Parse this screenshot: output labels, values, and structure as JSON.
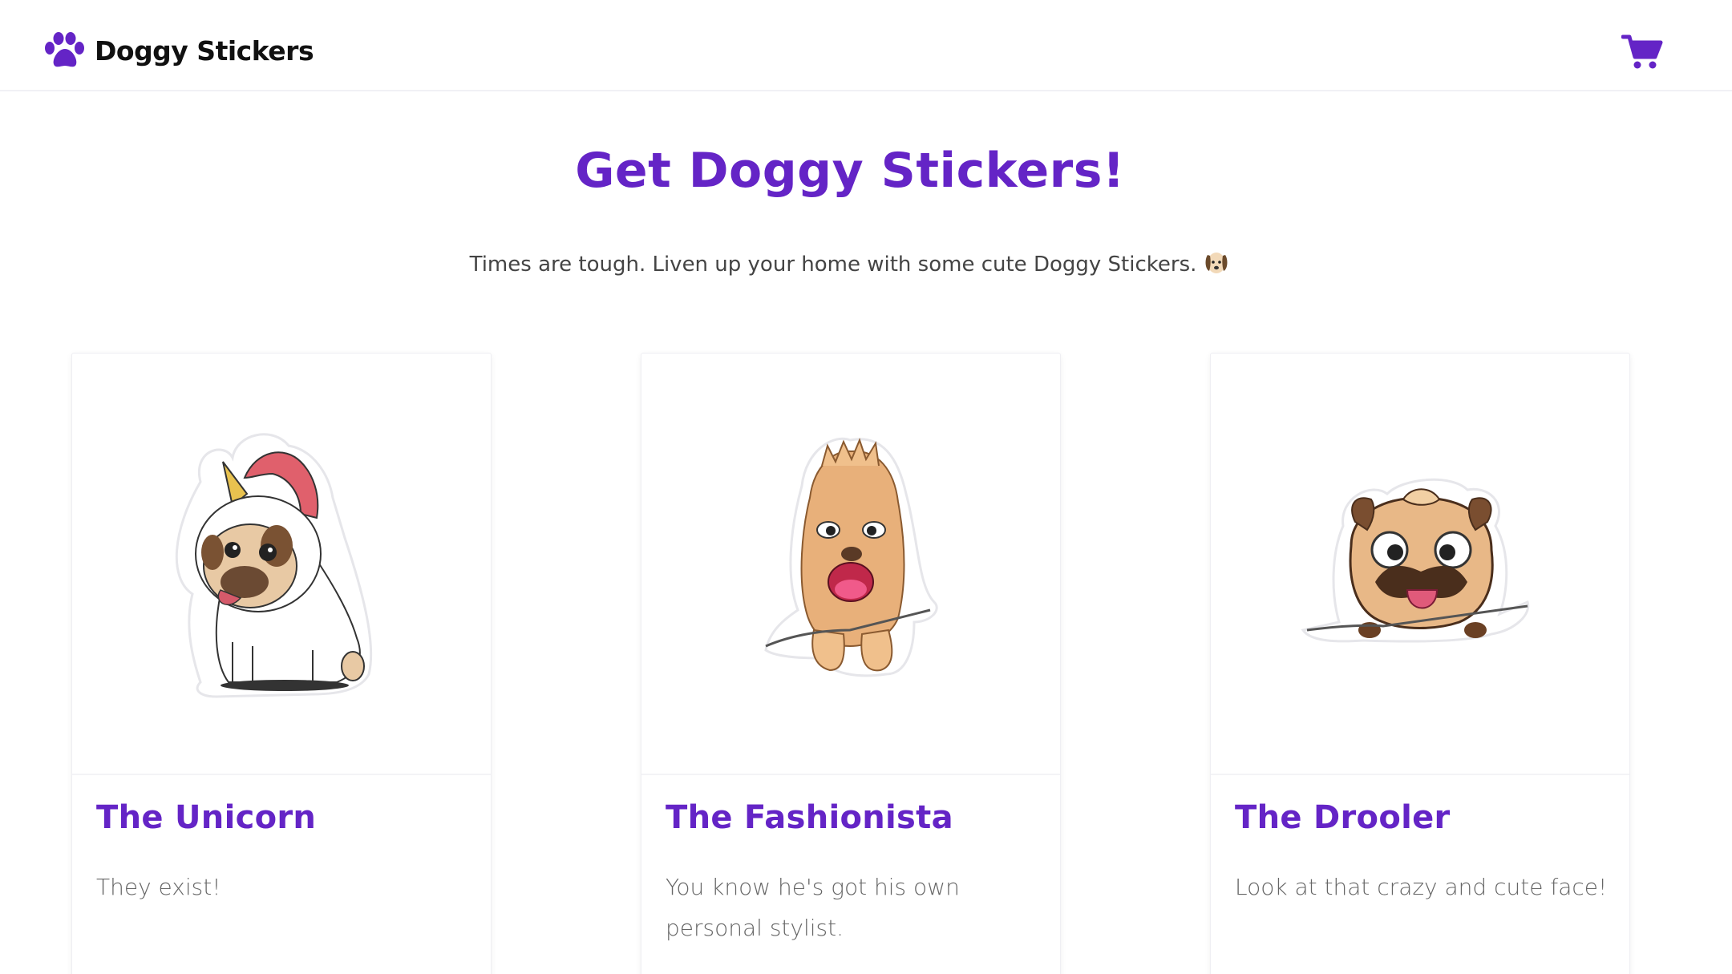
{
  "brand": {
    "name": "Doggy Stickers",
    "icon": "paw-icon"
  },
  "nav": {
    "cart_icon": "shopping-cart-icon"
  },
  "hero": {
    "title": "Get Doggy Stickers!",
    "subtitle": "Times are tough. Liven up your home with some cute Doggy Stickers.",
    "emoji": "dog-face-emoji"
  },
  "products": [
    {
      "title": "The Unicorn",
      "description": "They exist!",
      "image": "pug-unicorn-sticker"
    },
    {
      "title": "The Fashionista",
      "description": "You know he's got his own personal stylist.",
      "image": "shaggy-dog-sticker"
    },
    {
      "title": "The Drooler",
      "description": "Look at that crazy and cute face!",
      "image": "pug-drooler-sticker"
    }
  ],
  "colors": {
    "accent": "#6424c6",
    "text": "#111111",
    "muted": "#666666"
  }
}
